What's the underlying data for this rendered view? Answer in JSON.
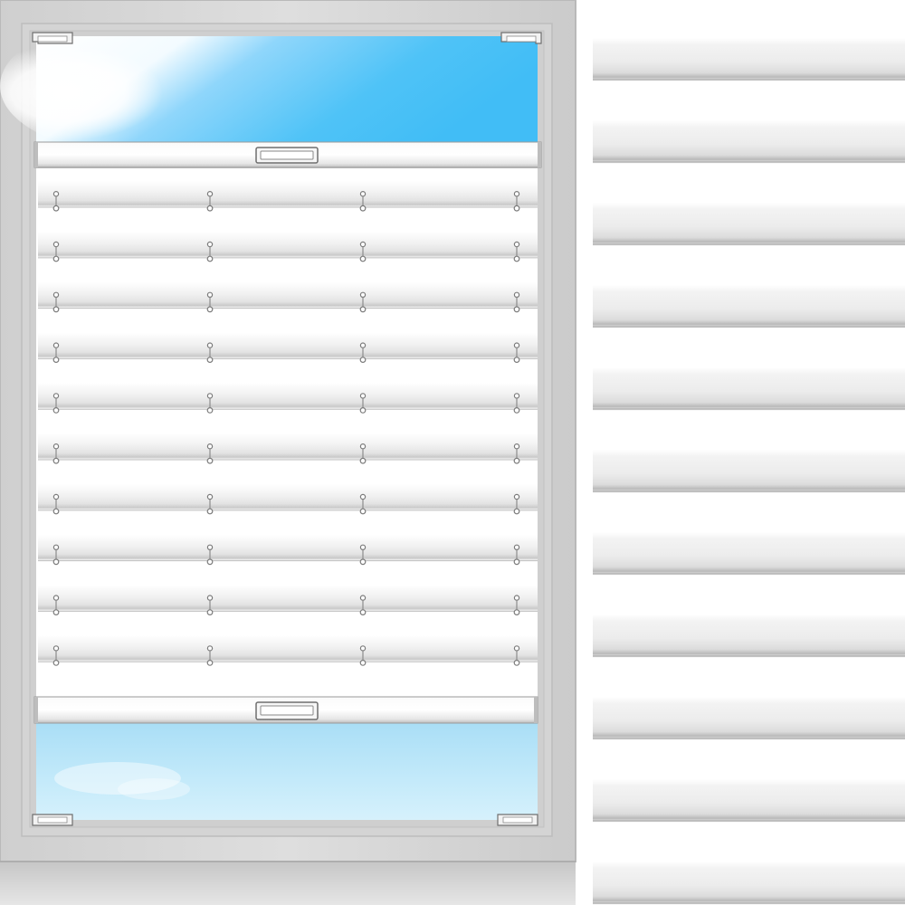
{
  "product_view": {
    "window": {
      "frame_color": "#d9d9d9",
      "sky_top_color": "#4fc3f7",
      "sky_bottom_color": "#bfe8f8",
      "fabric_color": "#ffffff"
    },
    "blind": {
      "pleat_count": 10,
      "cord_columns": 4,
      "upper_rail_handle_icon": "rail-handle-icon",
      "lower_rail_handle_icon": "rail-handle-icon",
      "cord_eyelet_icon": "cord-eyelet-icon",
      "corner_clip_icon": "corner-clip-icon"
    },
    "fabric_detail": {
      "pleat_count": 11
    }
  }
}
